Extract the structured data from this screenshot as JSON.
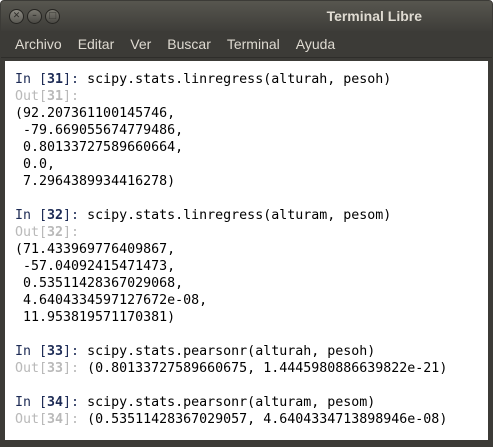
{
  "window": {
    "title": "Terminal Libre"
  },
  "menu": [
    "Archivo",
    "Editar",
    "Ver",
    "Buscar",
    "Terminal",
    "Ayuda"
  ],
  "cells": [
    {
      "in_num": "31",
      "command": "scipy.stats.linregress(alturah, pesoh)",
      "out_num": "31",
      "output_lines": [
        "(92.207361100145746,",
        " -79.669055674779486,",
        " 0.80133727589660664,",
        " 0.0,",
        " 7.2964389934416278)"
      ]
    },
    {
      "in_num": "32",
      "command": "scipy.stats.linregress(alturam, pesom)",
      "out_num": "32",
      "output_lines": [
        "(71.433969776409867,",
        " -57.04092415471473,",
        " 0.53511428367029068,",
        " 4.6404334597127672e-08,",
        " 11.953819571170381)"
      ]
    },
    {
      "in_num": "33",
      "command": "scipy.stats.pearsonr(alturah, pesoh)",
      "out_num": "33",
      "output_inline": "(0.80133727589660675, 1.4445980886639822e-21)"
    },
    {
      "in_num": "34",
      "command": "scipy.stats.pearsonr(alturam, pesom)",
      "out_num": "34",
      "output_inline": "(0.53511428367029057, 4.6404334713898946e-08)"
    }
  ]
}
